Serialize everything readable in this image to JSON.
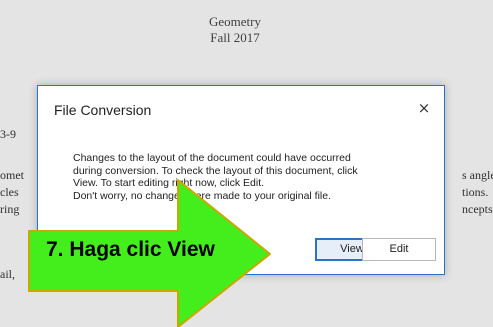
{
  "document": {
    "title_line1": "Geometry",
    "title_line2": "Fall 2017",
    "left_fragments": [
      "3-9",
      "omet",
      "cles",
      "ring",
      "ail,"
    ],
    "right_fragments": [
      "s angle",
      "tions.",
      "ncepts"
    ]
  },
  "dialog": {
    "title": "File Conversion",
    "close_glyph": "×",
    "message_lines": [
      "Changes to the layout of the document could have occurred",
      "during conversion. To check the layout of this document, click",
      "View. To start editing right now, click Edit.",
      "Don't worry, no changes were made to your original file."
    ],
    "view_label": "View",
    "edit_label": "Edit"
  },
  "annotation": {
    "label": "7. Haga clic View",
    "arrow_color": "#44ee1c",
    "arrow_outline": "#c9a800"
  }
}
